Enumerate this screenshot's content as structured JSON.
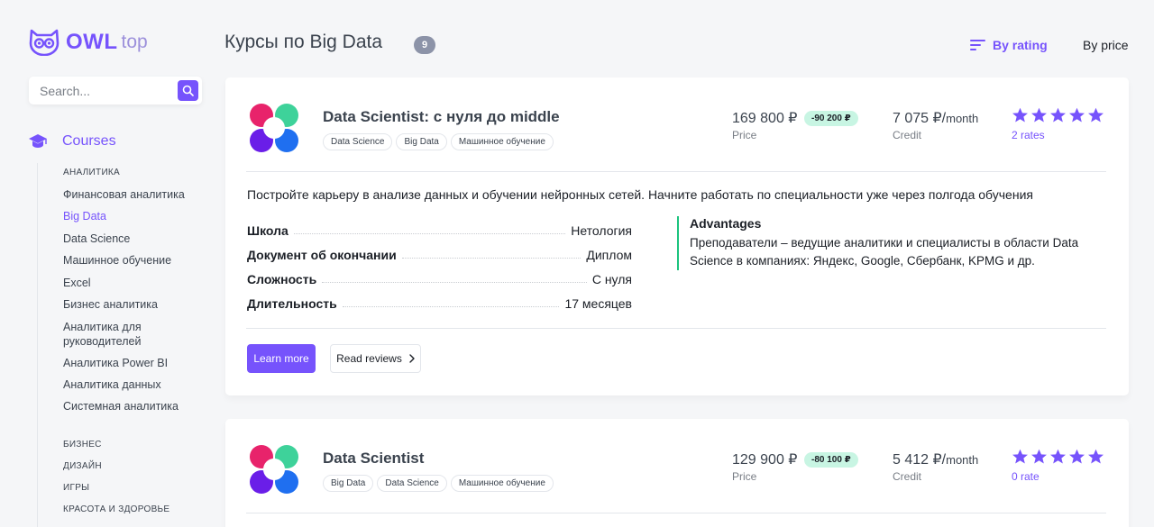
{
  "brand": {
    "name": "OWL",
    "suffix": "top"
  },
  "search": {
    "placeholder": "Search..."
  },
  "sidebar": {
    "section_label": "Courses",
    "categories_top": [
      "АНАЛИТИКА"
    ],
    "items": [
      "Финансовая аналитика",
      "Big Data",
      "Data Science",
      "Машинное обучение",
      "Excel",
      "Бизнес аналитика",
      "Аналитика для руководителей",
      "Аналитика Power BI",
      "Аналитика данных",
      "Системная аналитика"
    ],
    "active_item": "Big Data",
    "categories_bottom": [
      "БИЗНЕС",
      "ДИЗАЙН",
      "ИГРЫ",
      "КРАСОТА И ЗДОРОВЬЕ"
    ]
  },
  "header": {
    "title": "Курсы по Big Data",
    "count": "9",
    "sort_rating": "By rating",
    "sort_price": "By price"
  },
  "courses": [
    {
      "title": "Data Scientist: с нуля до middle",
      "tags": [
        "Data Science",
        "Big Data",
        "Машинное обучение"
      ],
      "price": "169 800 ₽",
      "discount": "-90 200 ₽",
      "price_label": "Price",
      "credit": "7 075 ₽/",
      "credit_period": "month",
      "credit_label": "Credit",
      "rating": 5,
      "rates": "2 rates",
      "description": "Постройте карьеру в анализе данных и обучении нейронных сетей. Начните работать по специальности уже через полгода обучения",
      "features": [
        {
          "key": "Школа",
          "value": "Нетология"
        },
        {
          "key": "Документ об окончании",
          "value": "Диплом"
        },
        {
          "key": "Сложность",
          "value": "С нуля"
        },
        {
          "key": "Длительность",
          "value": "17 месяцев"
        }
      ],
      "advantages_title": "Advantages",
      "advantages_text": "Преподаватели – ведущие аналитики и специалисты в области Data Science в компаниях: Яндекс, Google, Сбербанк, KPMG и др.",
      "learn_more": "Learn more",
      "read_reviews": "Read reviews"
    },
    {
      "title": "Data Scientist",
      "tags": [
        "Big Data",
        "Data Science",
        "Машинное обучение"
      ],
      "price": "129 900 ₽",
      "discount": "-80 100 ₽",
      "price_label": "Price",
      "credit": "5 412 ₽/",
      "credit_period": "month",
      "credit_label": "Credit",
      "rating": 5,
      "rates": "0 rate"
    }
  ],
  "colors": {
    "accent": "#7653fc",
    "discount_bg": "#c8f5e3",
    "advantage_border": "#1cc37e"
  }
}
